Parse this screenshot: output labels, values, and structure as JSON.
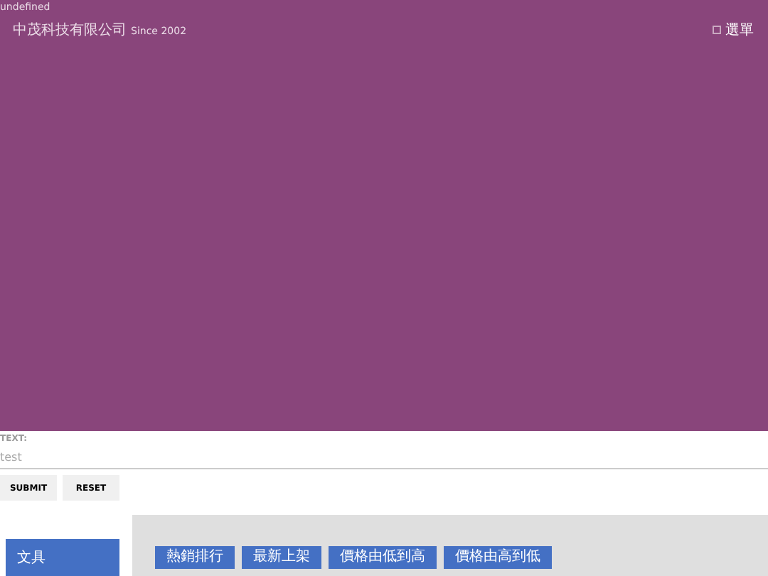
{
  "debug_text": "undefined",
  "header": {
    "brand": "中茂科技有限公司",
    "since": "Since 2002",
    "menu_label": "選單"
  },
  "form": {
    "label": "TEXT:",
    "placeholder": "test",
    "buttons": [
      "SUBMIT",
      "RESET"
    ]
  },
  "sidebar": {
    "items": [
      {
        "label": "文具",
        "selected": true
      }
    ]
  },
  "sort_buttons": [
    "熱銷排行",
    "最新上架",
    "價格由低到高",
    "價格由高到低"
  ]
}
